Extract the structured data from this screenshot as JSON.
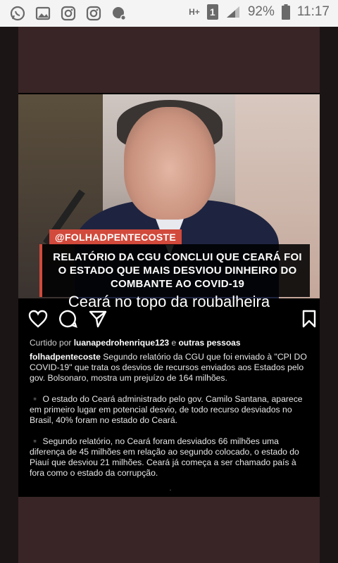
{
  "status_bar": {
    "battery_percent": "92%",
    "time": "11:17",
    "left_icons": [
      "whatsapp-icon",
      "gallery-icon",
      "instagram-icon",
      "instagram-icon-2",
      "app-icon"
    ],
    "right_icons": [
      "signal-hplus-icon",
      "sim-icon",
      "signal-bars-icon",
      "battery-icon"
    ],
    "network_label": "H+",
    "sim_label": "1"
  },
  "post": {
    "tag": "@FOLHADPENTECOSTE",
    "headline": "RELATÓRIO DA CGU CONCLUI QUE CEARÁ FOI O ESTADO QUE MAIS DESVIOU DINHEIRO DO COMBANTE AO COVID-19",
    "big_caption": "Ceará no topo da roubalheira",
    "likes_prefix": "Curtido por",
    "likes_user": "luanapedrohenrique123",
    "likes_mid": "e",
    "likes_others": "outras pessoas",
    "author": "folhadpentecoste",
    "paragraph_1": "Segundo relatório da CGU que foi enviado à \"CPI DO COVID-19\" que trata os desvios de recursos enviados aos Estados pelo gov. Bolsonaro, mostra um prejuízo de 164 milhões.",
    "paragraph_2": "▪️ O estado do Ceará administrado pelo gov. Camilo Santana, aparece em primeiro lugar em potencial desvio, de todo recurso desviados no Brasil, 40% foram no estado do Ceará.",
    "paragraph_3": "▪️ Segundo relatório, no Ceará foram desviados 66 milhões uma diferença de 45 milhões em relação ao segundo colocado, o estado do Piauí que desviou 21 milhões. Ceará já começa a ser chamado país à fora como o estado da corrupção.",
    "separator": "."
  },
  "colors": {
    "accent_red": "#d24a3c",
    "card_bg": "#000000",
    "page_bg": "#3a2526"
  }
}
